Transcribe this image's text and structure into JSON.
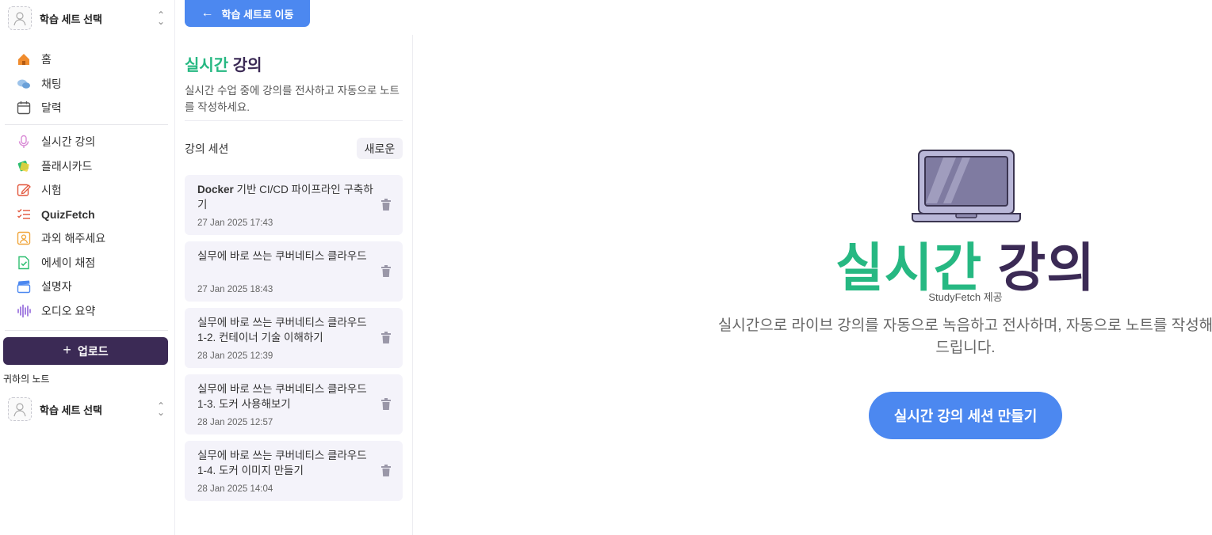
{
  "sidebar": {
    "set_selector_top": {
      "label": "학습 세트 선택",
      "icon": "study-set-avatar"
    },
    "nav_group1": [
      {
        "label": "홈",
        "icon": "home-icon",
        "color": "#f08c2e"
      },
      {
        "label": "채팅",
        "icon": "chat-icon",
        "color": "#6aa0d8"
      },
      {
        "label": "달력",
        "icon": "calendar-icon",
        "color": "#555555"
      }
    ],
    "nav_group2": [
      {
        "label": "실시간 강의",
        "icon": "microphone-icon",
        "color": "#d98bd6"
      },
      {
        "label": "플래시카드",
        "icon": "flashcards-icon",
        "color": "#2fbf71"
      },
      {
        "label": "시험",
        "icon": "edit-icon",
        "color": "#e2563b"
      },
      {
        "label": "QuizFetch",
        "icon": "checklist-icon",
        "color": "#e2563b"
      },
      {
        "label": "과외 해주세요",
        "icon": "tutor-icon",
        "color": "#f0a53a"
      },
      {
        "label": "에세이 채점",
        "icon": "document-check-icon",
        "color": "#2fbf71"
      },
      {
        "label": "설명자",
        "icon": "clapperboard-icon",
        "color": "#4c88f0"
      },
      {
        "label": "오디오 요약",
        "icon": "audio-wave-icon",
        "color": "#8a5cd8"
      }
    ],
    "upload_label": "업로드",
    "my_notes_label": "귀하의 노트",
    "set_selector_bottom": {
      "label": "학습 세트 선택",
      "icon": "study-set-avatar"
    }
  },
  "top": {
    "back_label": "학습 세트로 이동"
  },
  "middle": {
    "title_green": "실시간",
    "title_dark": "강의",
    "description": "실시간 수업 중에 강의를 전사하고 자동으로 노트를 작성하세요.",
    "sessions_label": "강의 세션",
    "new_label": "새로운",
    "sessions": [
      {
        "title_bold": "Docker",
        "title_rest": " 기반 CI/CD 파이프라인 구축하기",
        "date": "27 Jan 2025 17:43"
      },
      {
        "title_bold": "",
        "title_rest": "실무에 바로 쓰는 쿠버네티스 클라우드",
        "date": "27 Jan 2025 18:43"
      },
      {
        "title_bold": "",
        "title_rest": "실무에 바로 쓰는 쿠버네티스 클라우드 1-2. 컨테이너 기술 이해하기",
        "date": "28 Jan 2025 12:39"
      },
      {
        "title_bold": "",
        "title_rest": "실무에 바로 쓰는 쿠버네티스 클라우드 1-3. 도커 사용해보기",
        "date": "28 Jan 2025 12:57"
      },
      {
        "title_bold": "",
        "title_rest": "실무에 바로 쓰는 쿠버네티스 클라우드 1-4. 도커 이미지 만들기",
        "date": "28 Jan 2025 14:04"
      }
    ]
  },
  "hero": {
    "title_green": "실시간",
    "title_dark": "강의",
    "powered_by": "StudyFetch 제공",
    "description": "실시간으로 라이브 강의를 자동으로 녹음하고 전사하며, 자동으로 노트를 작성해 드립니다.",
    "cta_label": "실시간 강의 세션 만들기"
  },
  "colors": {
    "accent_blue": "#4c88f0",
    "brand_green": "#26b882",
    "brand_dark": "#3b2a55"
  }
}
